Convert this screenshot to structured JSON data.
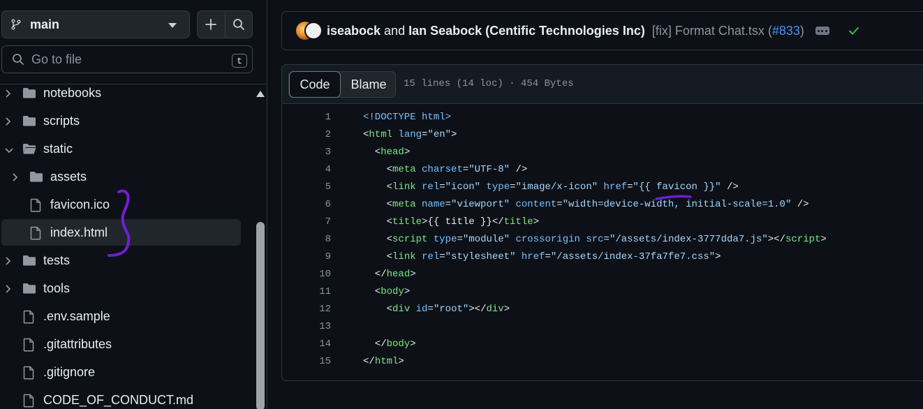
{
  "sidebar": {
    "branch": "main",
    "goto_placeholder": "Go to file",
    "goto_shortcut": "t",
    "tree": [
      {
        "label": "notebooks",
        "type": "folder",
        "expanded": false,
        "depth": 0
      },
      {
        "label": "scripts",
        "type": "folder",
        "expanded": false,
        "depth": 0
      },
      {
        "label": "static",
        "type": "folder",
        "expanded": true,
        "depth": 0
      },
      {
        "label": "assets",
        "type": "folder",
        "expanded": false,
        "depth": 1
      },
      {
        "label": "favicon.ico",
        "type": "file",
        "depth": 1
      },
      {
        "label": "index.html",
        "type": "file",
        "depth": 1,
        "selected": true
      },
      {
        "label": "tests",
        "type": "folder",
        "expanded": false,
        "depth": 0
      },
      {
        "label": "tools",
        "type": "folder",
        "expanded": false,
        "depth": 0
      },
      {
        "label": ".env.sample",
        "type": "file",
        "depth": 0
      },
      {
        "label": ".gitattributes",
        "type": "file",
        "depth": 0
      },
      {
        "label": ".gitignore",
        "type": "file",
        "depth": 0
      },
      {
        "label": "CODE_OF_CONDUCT.md",
        "type": "file",
        "depth": 0
      }
    ]
  },
  "commit": {
    "author1": "iseabock",
    "joiner": "and",
    "author2": "Ian Seabock (Centific Technologies Inc)",
    "message": "[fix] Format Chat.tsx (",
    "pr": "#833",
    "message_end": ")",
    "status": "success"
  },
  "file": {
    "tab_code": "Code",
    "tab_blame": "Blame",
    "info": "15 lines (14 loc) · 454 Bytes"
  },
  "code_lines": [
    [
      [
        "tk",
        "<!DOCTYPE html>"
      ]
    ],
    [
      [
        "tp",
        "<"
      ],
      [
        "tg",
        "html"
      ],
      [
        "tp",
        " "
      ],
      [
        "tk",
        "lang"
      ],
      [
        "tp",
        "="
      ],
      [
        "ts",
        "\"en\""
      ],
      [
        "tp",
        ">"
      ]
    ],
    [
      [
        "tp",
        "  <"
      ],
      [
        "tg",
        "head"
      ],
      [
        "tp",
        ">"
      ]
    ],
    [
      [
        "tp",
        "    <"
      ],
      [
        "tg",
        "meta"
      ],
      [
        "tp",
        " "
      ],
      [
        "tk",
        "charset"
      ],
      [
        "tp",
        "="
      ],
      [
        "ts",
        "\"UTF-8\""
      ],
      [
        "tp",
        " />"
      ]
    ],
    [
      [
        "tp",
        "    <"
      ],
      [
        "tg",
        "link"
      ],
      [
        "tp",
        " "
      ],
      [
        "tk",
        "rel"
      ],
      [
        "tp",
        "="
      ],
      [
        "ts",
        "\"icon\""
      ],
      [
        "tp",
        " "
      ],
      [
        "tk",
        "type"
      ],
      [
        "tp",
        "="
      ],
      [
        "ts",
        "\"image/x-icon\""
      ],
      [
        "tp",
        " "
      ],
      [
        "tk",
        "href"
      ],
      [
        "tp",
        "="
      ],
      [
        "ts",
        "\"{{ favicon }}\""
      ],
      [
        "tp",
        " />"
      ]
    ],
    [
      [
        "tp",
        "    <"
      ],
      [
        "tg",
        "meta"
      ],
      [
        "tp",
        " "
      ],
      [
        "tk",
        "name"
      ],
      [
        "tp",
        "="
      ],
      [
        "ts",
        "\"viewport\""
      ],
      [
        "tp",
        " "
      ],
      [
        "tk",
        "content"
      ],
      [
        "tp",
        "="
      ],
      [
        "ts",
        "\"width=device-width, initial-scale=1.0\""
      ],
      [
        "tp",
        " />"
      ]
    ],
    [
      [
        "tp",
        "    <"
      ],
      [
        "tg",
        "title"
      ],
      [
        "tp",
        ">{{ title }}</"
      ],
      [
        "tg",
        "title"
      ],
      [
        "tp",
        ">"
      ]
    ],
    [
      [
        "tp",
        "    <"
      ],
      [
        "tg",
        "script"
      ],
      [
        "tp",
        " "
      ],
      [
        "tk",
        "type"
      ],
      [
        "tp",
        "="
      ],
      [
        "ts",
        "\"module\""
      ],
      [
        "tp",
        " "
      ],
      [
        "tk",
        "crossorigin"
      ],
      [
        "tp",
        " "
      ],
      [
        "tk",
        "src"
      ],
      [
        "tp",
        "="
      ],
      [
        "ts",
        "\"/assets/index-3777dda7.js\""
      ],
      [
        "tp",
        "></"
      ],
      [
        "tg",
        "script"
      ],
      [
        "tp",
        ">"
      ]
    ],
    [
      [
        "tp",
        "    <"
      ],
      [
        "tg",
        "link"
      ],
      [
        "tp",
        " "
      ],
      [
        "tk",
        "rel"
      ],
      [
        "tp",
        "="
      ],
      [
        "ts",
        "\"stylesheet\""
      ],
      [
        "tp",
        " "
      ],
      [
        "tk",
        "href"
      ],
      [
        "tp",
        "="
      ],
      [
        "ts",
        "\"/assets/index-37fa7fe7.css\""
      ],
      [
        "tp",
        ">"
      ]
    ],
    [
      [
        "tp",
        "  </"
      ],
      [
        "tg",
        "head"
      ],
      [
        "tp",
        ">"
      ]
    ],
    [
      [
        "tp",
        "  <"
      ],
      [
        "tg",
        "body"
      ],
      [
        "tp",
        ">"
      ]
    ],
    [
      [
        "tp",
        "    <"
      ],
      [
        "tg",
        "div"
      ],
      [
        "tp",
        " "
      ],
      [
        "tk",
        "id"
      ],
      [
        "tp",
        "="
      ],
      [
        "ts",
        "\"root\""
      ],
      [
        "tp",
        "></"
      ],
      [
        "tg",
        "div"
      ],
      [
        "tp",
        ">"
      ]
    ],
    [
      [
        "tp",
        ""
      ]
    ],
    [
      [
        "tp",
        "  </"
      ],
      [
        "tg",
        "body"
      ],
      [
        "tp",
        ">"
      ]
    ],
    [
      [
        "tp",
        "</"
      ],
      [
        "tg",
        "html"
      ],
      [
        "tp",
        ">"
      ]
    ]
  ],
  "colors": {
    "background": "#0d1117",
    "annotation": "#6e1fd6",
    "check": "#3fb950",
    "link": "#4493f8"
  }
}
